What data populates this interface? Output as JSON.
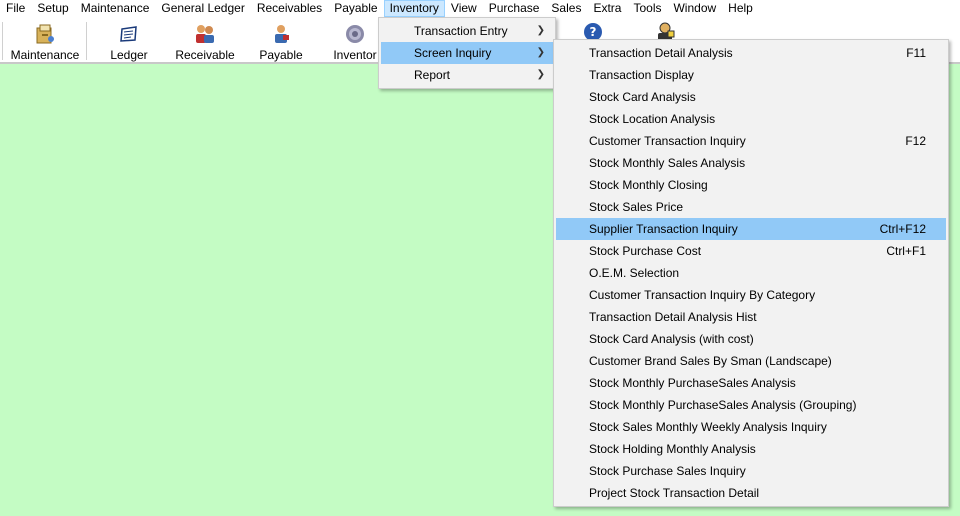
{
  "menubar": {
    "items": [
      "File",
      "Setup",
      "Maintenance",
      "General Ledger",
      "Receivables",
      "Payable",
      "Inventory",
      "View",
      "Purchase",
      "Sales",
      "Extra",
      "Tools",
      "Window",
      "Help"
    ],
    "active": "Inventory"
  },
  "toolbar": {
    "buttons": [
      {
        "label": "Maintenance",
        "icon": "folder-cabinet-icon"
      },
      {
        "label": "Ledger",
        "icon": "ledger-book-icon"
      },
      {
        "label": "Receivable",
        "icon": "people-icon"
      },
      {
        "label": "Payable",
        "icon": "payee-person-icon"
      },
      {
        "label": "Inventor",
        "icon": "gear-icon"
      }
    ],
    "right_icons": [
      "help-icon",
      "user-icon"
    ]
  },
  "inventory_menu": {
    "items": [
      {
        "label": "Transaction Entry",
        "submenu": true
      },
      {
        "label": "Screen Inquiry",
        "submenu": true,
        "highlighted": true
      },
      {
        "label": "Report",
        "submenu": true
      }
    ]
  },
  "screen_inquiry_menu": {
    "items": [
      {
        "label": "Transaction Detail Analysis",
        "shortcut": "F11"
      },
      {
        "label": "Transaction Display",
        "shortcut": ""
      },
      {
        "label": "Stock Card Analysis",
        "shortcut": ""
      },
      {
        "label": "Stock Location Analysis",
        "shortcut": ""
      },
      {
        "label": "Customer Transaction Inquiry",
        "shortcut": "F12"
      },
      {
        "label": "Stock Monthly Sales Analysis",
        "shortcut": ""
      },
      {
        "label": "Stock Monthly Closing",
        "shortcut": ""
      },
      {
        "label": "Stock Sales Price",
        "shortcut": ""
      },
      {
        "label": "Supplier Transaction Inquiry",
        "shortcut": "Ctrl+F12",
        "highlighted": true
      },
      {
        "label": "Stock Purchase Cost",
        "shortcut": "Ctrl+F1"
      },
      {
        "label": "O.E.M. Selection",
        "shortcut": ""
      },
      {
        "label": "Customer Transaction Inquiry By Category",
        "shortcut": ""
      },
      {
        "label": "Transaction Detail Analysis Hist",
        "shortcut": ""
      },
      {
        "label": "Stock Card Analysis (with cost)",
        "shortcut": ""
      },
      {
        "label": "Customer Brand Sales By Sman (Landscape)",
        "shortcut": ""
      },
      {
        "label": "Stock Monthly PurchaseSales Analysis",
        "shortcut": ""
      },
      {
        "label": "Stock Monthly PurchaseSales Analysis (Grouping)",
        "shortcut": ""
      },
      {
        "label": "Stock Sales Monthly Weekly Analysis Inquiry",
        "shortcut": ""
      },
      {
        "label": "Stock Holding Monthly Analysis",
        "shortcut": ""
      },
      {
        "label": "Stock Purchase Sales Inquiry",
        "shortcut": ""
      },
      {
        "label": "Project Stock Transaction Detail",
        "shortcut": ""
      }
    ]
  },
  "colors": {
    "workspace": "#c4fcc4",
    "menu_bg": "#f2f2f2",
    "highlight": "#91c9f7",
    "menubar_active": "#cce8ff"
  }
}
